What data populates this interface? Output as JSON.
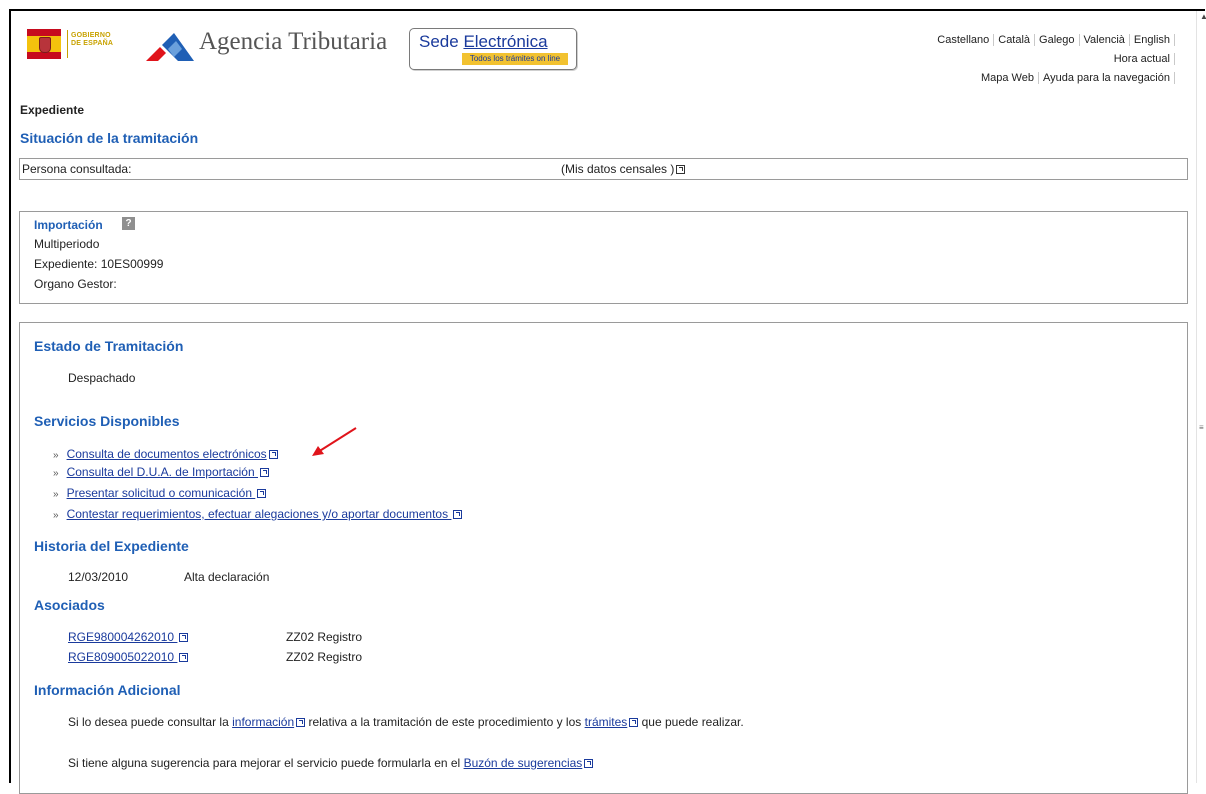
{
  "header": {
    "gobierno_line1": "GOBIERNO",
    "gobierno_line2": "DE ESPAÑA",
    "agency_name": "Agencia Tributaria",
    "sede_title_1": "Sede ",
    "sede_title_2": "Electrónica",
    "sede_subtitle": "Todos los trámites on line",
    "languages": [
      "Castellano",
      "Català",
      "Galego",
      "Valencià",
      "English"
    ],
    "hora_actual": "Hora actual",
    "mapa_web": "Mapa Web",
    "ayuda": "Ayuda para la navegación"
  },
  "page": {
    "heading": "Expediente",
    "section_title": "Situación de la tramitación"
  },
  "persona": {
    "label": "Persona consultada:",
    "mis_datos": "(Mis datos censales )"
  },
  "importacion": {
    "title": "Importación",
    "help": "?",
    "line1": "Multiperiodo",
    "line2": "Expediente: 10ES00999",
    "line3": "Organo Gestor:"
  },
  "estado": {
    "title": "Estado de Tramitación",
    "value": "Despachado"
  },
  "servicios": {
    "title": "Servicios Disponibles",
    "items": [
      "Consulta de documentos electrónicos",
      "Consulta del D.U.A. de Importación ",
      "Presentar solicitud o comunicación ",
      "Contestar requerimientos, efectuar alegaciones y/o aportar documentos "
    ]
  },
  "historia": {
    "title": "Historia del Expediente",
    "date": "12/03/2010",
    "event": "Alta declaración"
  },
  "asociados": {
    "title": "Asociados",
    "rows": [
      {
        "link": "RGE980004262010 ",
        "desc": "ZZ02 Registro"
      },
      {
        "link": "RGE809005022010 ",
        "desc": "ZZ02 Registro"
      }
    ]
  },
  "info": {
    "title": "Información Adicional",
    "p1_a": "Si lo desea puede consultar la ",
    "p1_link1": "información",
    "p1_b": " relativa a la tramitación de este procedimiento y los ",
    "p1_link2": "trámites",
    "p1_c": " que puede realizar.",
    "p2_a": "Si tiene alguna sugerencia para mejorar el servicio puede formularla en el ",
    "p2_link": "Buzón de sugerencias"
  },
  "colors": {
    "heading_blue": "#1f5fb5",
    "link_blue": "#1a3a9c",
    "annotation_red": "#e0141b"
  }
}
